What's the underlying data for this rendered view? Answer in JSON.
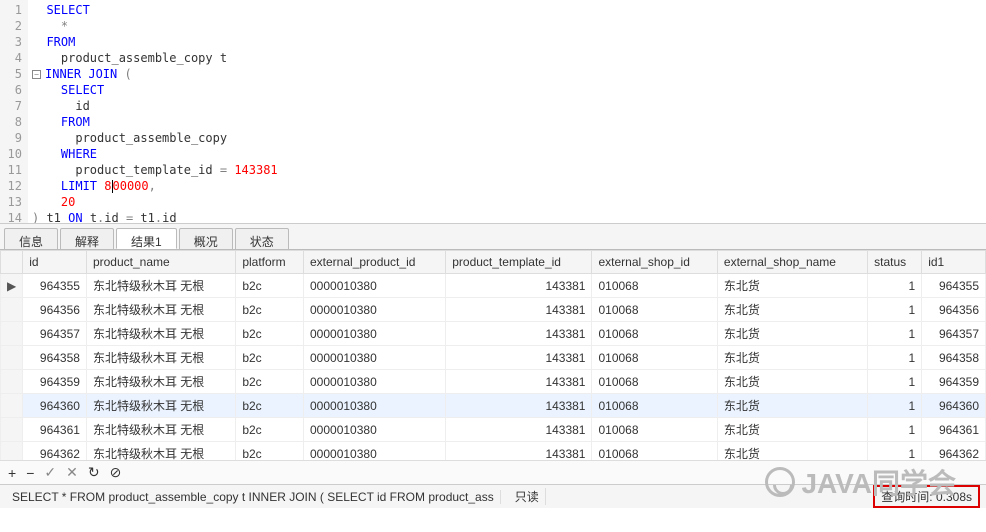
{
  "editor": {
    "lines": [
      {
        "n": "1",
        "html": "&nbsp;&nbsp;<span class='kw'>SELECT</span>"
      },
      {
        "n": "2",
        "html": "&nbsp;&nbsp;&nbsp;&nbsp;<span class='op'>*</span>"
      },
      {
        "n": "3",
        "html": "&nbsp;&nbsp;<span class='kw'>FROM</span>"
      },
      {
        "n": "4",
        "html": "&nbsp;&nbsp;&nbsp;&nbsp;product_assemble_copy t"
      },
      {
        "n": "5",
        "html": "<span class='kw'>INNER</span> <span class='kw'>JOIN</span> <span class='op'>(</span>",
        "fold": true
      },
      {
        "n": "6",
        "html": "&nbsp;&nbsp;&nbsp;&nbsp;<span class='kw'>SELECT</span>"
      },
      {
        "n": "7",
        "html": "&nbsp;&nbsp;&nbsp;&nbsp;&nbsp;&nbsp;id"
      },
      {
        "n": "8",
        "html": "&nbsp;&nbsp;&nbsp;&nbsp;<span class='kw'>FROM</span>"
      },
      {
        "n": "9",
        "html": "&nbsp;&nbsp;&nbsp;&nbsp;&nbsp;&nbsp;product_assemble_copy"
      },
      {
        "n": "10",
        "html": "&nbsp;&nbsp;&nbsp;&nbsp;<span class='kw'>WHERE</span>"
      },
      {
        "n": "11",
        "html": "&nbsp;&nbsp;&nbsp;&nbsp;&nbsp;&nbsp;product_template_id <span class='op'>=</span> <span class='num'>143381</span>"
      },
      {
        "n": "12",
        "html": "&nbsp;&nbsp;&nbsp;&nbsp;<span class='kw'>LIMIT</span> <span class='num'>8</span><span class='caret'></span><span class='num'>00000</span><span class='op'>,</span>"
      },
      {
        "n": "13",
        "html": "&nbsp;&nbsp;&nbsp;&nbsp;<span class='num'>20</span>"
      },
      {
        "n": "14",
        "html": "<span class='op'>)</span> t1 <span class='kw'>ON</span> t<span class='op'>.</span>id <span class='op'>=</span> t1<span class='op'>.</span>id"
      }
    ]
  },
  "tabs": [
    {
      "label": "信息",
      "active": false
    },
    {
      "label": "解释",
      "active": false
    },
    {
      "label": "结果1",
      "active": true
    },
    {
      "label": "概况",
      "active": false
    },
    {
      "label": "状态",
      "active": false
    }
  ],
  "grid": {
    "columns": [
      "id",
      "product_name",
      "platform",
      "external_product_id",
      "product_template_id",
      "external_shop_id",
      "external_shop_name",
      "status",
      "id1"
    ],
    "rows": [
      {
        "marker": "▶",
        "id": "964355",
        "product_name": "东北特级秋木耳 无根",
        "platform": "b2c",
        "external_product_id": "0000010380",
        "product_template_id": "143381",
        "external_shop_id": "010068",
        "external_shop_name": "东北货",
        "status": "1",
        "id1": "964355"
      },
      {
        "marker": "",
        "id": "964356",
        "product_name": "东北特级秋木耳 无根",
        "platform": "b2c",
        "external_product_id": "0000010380",
        "product_template_id": "143381",
        "external_shop_id": "010068",
        "external_shop_name": "东北货",
        "status": "1",
        "id1": "964356"
      },
      {
        "marker": "",
        "id": "964357",
        "product_name": "东北特级秋木耳 无根",
        "platform": "b2c",
        "external_product_id": "0000010380",
        "product_template_id": "143381",
        "external_shop_id": "010068",
        "external_shop_name": "东北货",
        "status": "1",
        "id1": "964357"
      },
      {
        "marker": "",
        "id": "964358",
        "product_name": "东北特级秋木耳 无根",
        "platform": "b2c",
        "external_product_id": "0000010380",
        "product_template_id": "143381",
        "external_shop_id": "010068",
        "external_shop_name": "东北货",
        "status": "1",
        "id1": "964358"
      },
      {
        "marker": "",
        "id": "964359",
        "product_name": "东北特级秋木耳 无根",
        "platform": "b2c",
        "external_product_id": "0000010380",
        "product_template_id": "143381",
        "external_shop_id": "010068",
        "external_shop_name": "东北货",
        "status": "1",
        "id1": "964359"
      },
      {
        "marker": "",
        "id": "964360",
        "product_name": "东北特级秋木耳 无根",
        "platform": "b2c",
        "external_product_id": "0000010380",
        "product_template_id": "143381",
        "external_shop_id": "010068",
        "external_shop_name": "东北货",
        "status": "1",
        "id1": "964360",
        "selected": true
      },
      {
        "marker": "",
        "id": "964361",
        "product_name": "东北特级秋木耳 无根",
        "platform": "b2c",
        "external_product_id": "0000010380",
        "product_template_id": "143381",
        "external_shop_id": "010068",
        "external_shop_name": "东北货",
        "status": "1",
        "id1": "964361"
      },
      {
        "marker": "",
        "id": "964362",
        "product_name": "东北特级秋木耳 无根",
        "platform": "b2c",
        "external_product_id": "0000010380",
        "product_template_id": "143381",
        "external_shop_id": "010068",
        "external_shop_name": "东北货",
        "status": "1",
        "id1": "964362"
      }
    ]
  },
  "toolbar": {
    "add": "+",
    "remove": "−",
    "confirm": "✓",
    "cancel": "✕",
    "refresh": "↻",
    "stop": "⊘"
  },
  "statusbar": {
    "sql_parts": [
      "SELECT",
      "* FROM",
      "product_assemble_copy t INNER JOIN (",
      "SELECT",
      "id",
      "FROM",
      "product_ass"
    ],
    "readonly": "只读",
    "query_time": "查询时间: 0.308s"
  },
  "watermark": "JAVA同学会"
}
